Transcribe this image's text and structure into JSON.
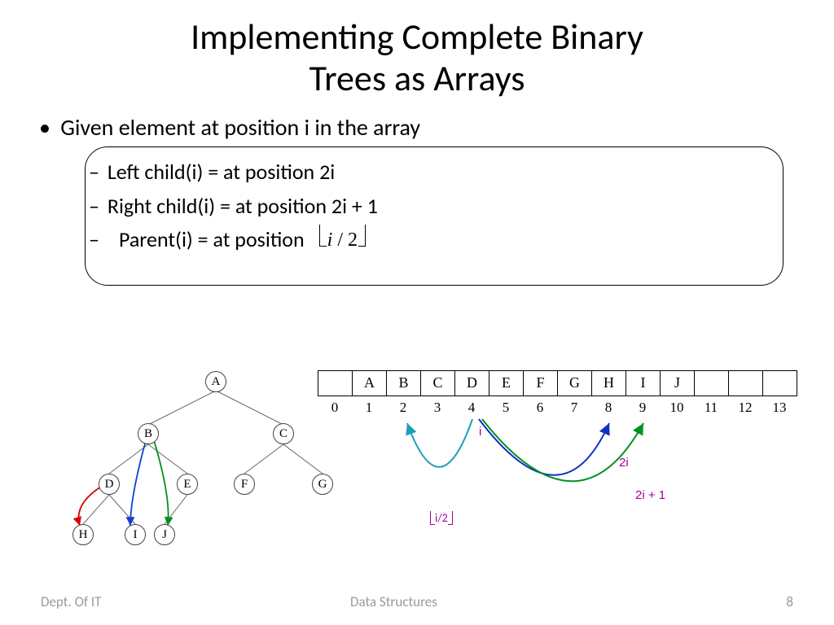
{
  "title_line1": "Implementing Complete Binary",
  "title_line2": "Trees as Arrays",
  "bullets": {
    "main": "Given element at position i in the array",
    "sub1": "Left child(i) = at position 2i",
    "sub2": "Right child(i) = at position 2i + 1",
    "sub3": "Parent(i) = at position",
    "floor_expr": "i / 2"
  },
  "tree": {
    "nodes": [
      "A",
      "B",
      "C",
      "D",
      "E",
      "F",
      "G",
      "H",
      "I",
      "J"
    ]
  },
  "array": {
    "cells": [
      "",
      "A",
      "B",
      "C",
      "D",
      "E",
      "F",
      "G",
      "H",
      "I",
      "J",
      "",
      "",
      ""
    ],
    "indices": [
      "0",
      "1",
      "2",
      "3",
      "4",
      "5",
      "6",
      "7",
      "8",
      "9",
      "10",
      "11",
      "12",
      "13"
    ]
  },
  "labels": {
    "i": "i",
    "two_i": "2i",
    "two_i_plus_1": "2i + 1",
    "i_half": "i/2"
  },
  "footer": {
    "left": "Dept. Of  IT",
    "mid": "Data Structures",
    "page": "8"
  }
}
